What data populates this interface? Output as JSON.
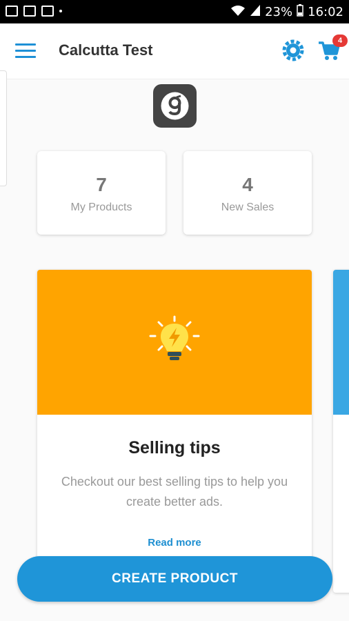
{
  "status_bar": {
    "battery": "23%",
    "time": "16:02"
  },
  "header": {
    "title": "Calcutta Test",
    "cart_count": "4"
  },
  "stats": [
    {
      "value": "7",
      "label": "My Products"
    },
    {
      "value": "4",
      "label": "New Sales"
    }
  ],
  "card": {
    "title": "Selling tips",
    "description": "Checkout our best selling tips to help you create better ads.",
    "link": "Read more"
  },
  "cta": {
    "label": "CREATE PRODUCT"
  },
  "colors": {
    "accent": "#1f95d8",
    "banner": "#ffa400",
    "badge": "#e53935"
  }
}
